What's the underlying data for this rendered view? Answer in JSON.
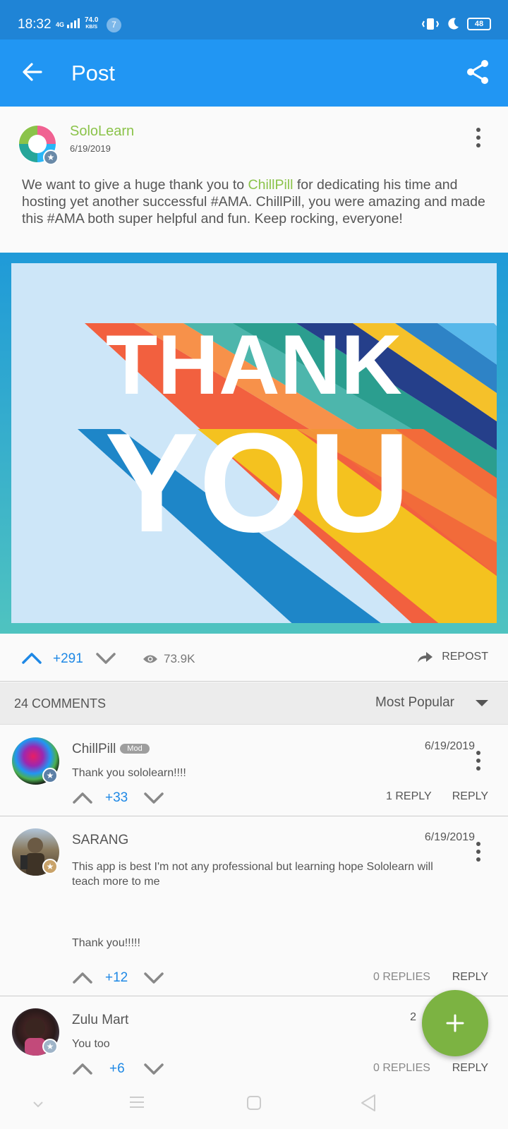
{
  "status": {
    "time": "18:32",
    "network": "4G",
    "speed_value": "74.0",
    "speed_unit": "KB/S",
    "notifications": "7",
    "battery": "48"
  },
  "app_bar": {
    "title": "Post"
  },
  "post": {
    "author": "SoloLearn",
    "date": "6/19/2019",
    "text_before": "We want to give a huge thank you to ",
    "mention": "ChillPill",
    "text_after": " for dedicating his time and hosting yet another successful #AMA. ChillPill, you were amazing and made this #AMA both super helpful and fun. Keep rocking, everyone!",
    "image_line1": "THANK",
    "image_line2": "YOU",
    "votes": "+291",
    "views": "73.9K",
    "repost_label": "REPOST"
  },
  "comments_header": {
    "count_label": "24 COMMENTS",
    "sort_value": "Most Popular"
  },
  "comments": [
    {
      "name": "ChillPill",
      "tag": "Mod",
      "date": "6/19/2019",
      "text": "Thank you sololearn!!!!",
      "votes": "+33",
      "replies": "1 REPLY",
      "reply_label": "REPLY"
    },
    {
      "name": "SARANG",
      "date": "6/19/2019",
      "text": "This app is best I'm not any professional  but learning hope Sololearn will teach more to me",
      "text2": "Thank you!!!!!",
      "votes": "+12",
      "replies": "0 REPLIES",
      "reply_label": "REPLY"
    },
    {
      "name": "Zulu Mart",
      "date": "2",
      "text": "You too",
      "votes": "+6",
      "replies": "0 REPLIES",
      "reply_label": "REPLY"
    }
  ],
  "colors": {
    "status_bar": "#1f84d6",
    "app_bar": "#2196f3",
    "accent_green": "#8bc34a",
    "vote_blue": "#1e88e5",
    "fab": "#7cb342"
  },
  "icons": [
    "back-arrow-icon",
    "share-icon",
    "more-vert-icon",
    "upvote-icon",
    "downvote-icon",
    "eye-icon",
    "repost-icon",
    "dropdown-caret-icon",
    "plus-icon",
    "nav-down-icon",
    "nav-menu-icon",
    "nav-home-icon",
    "nav-back-icon"
  ]
}
